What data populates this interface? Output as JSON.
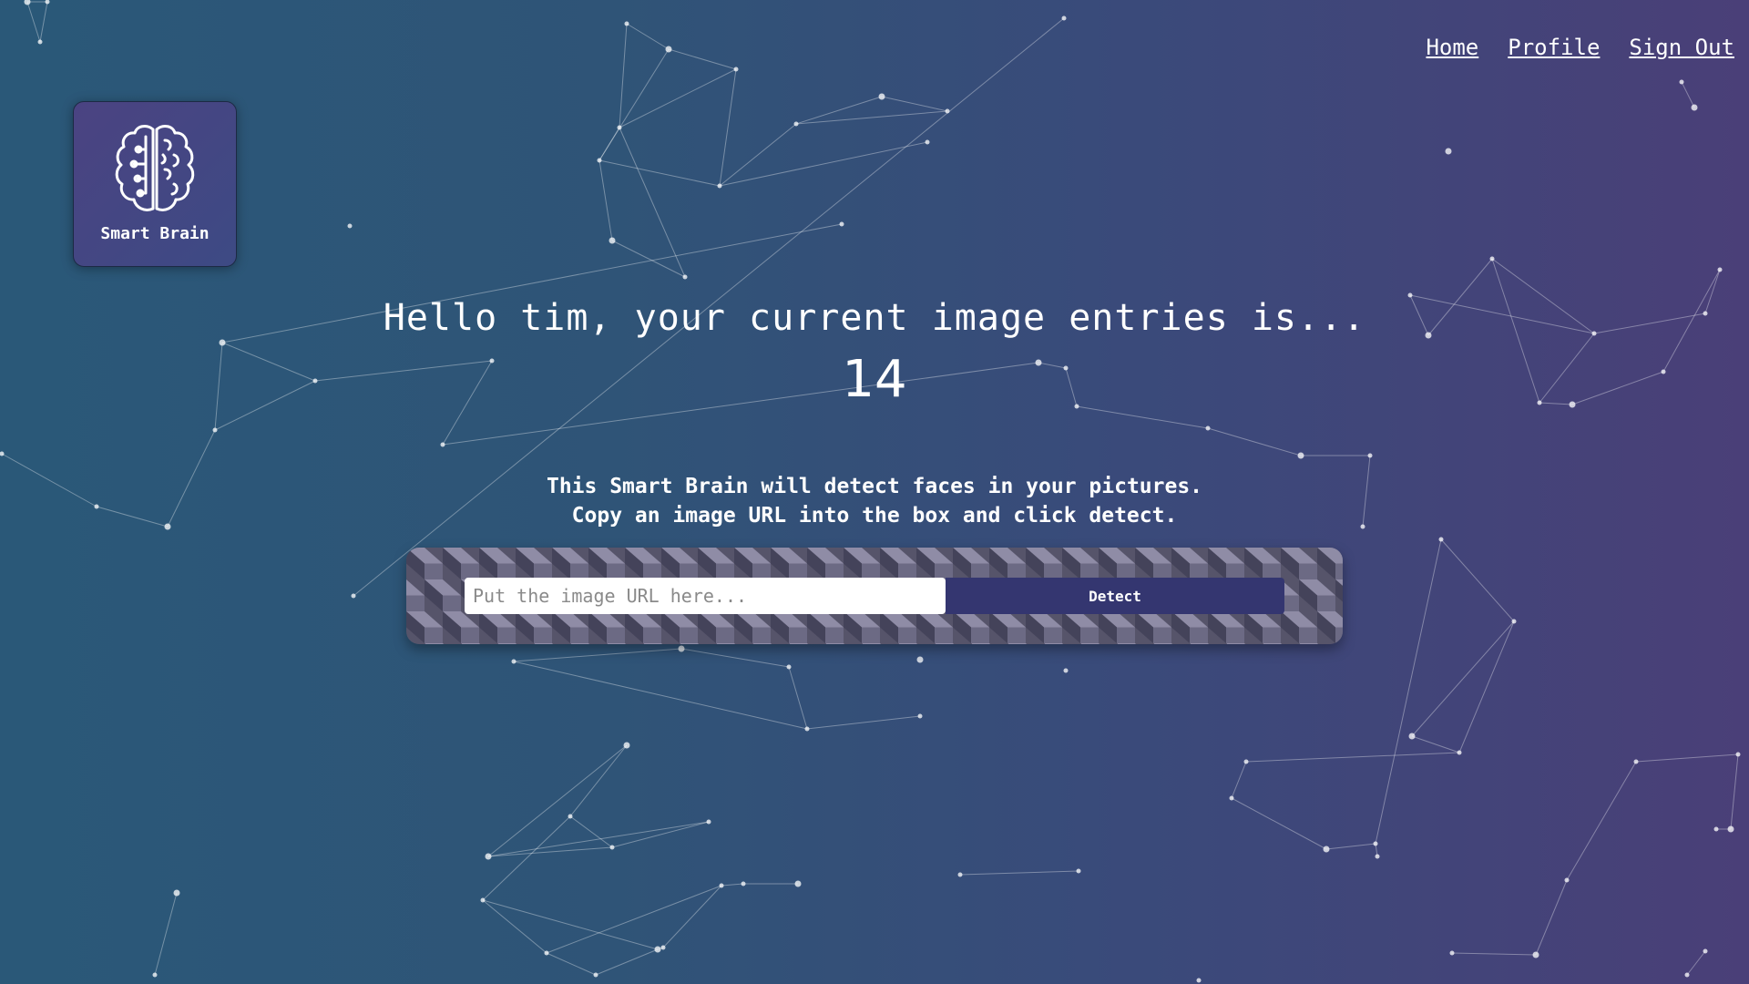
{
  "nav": {
    "home": "Home",
    "profile": "Profile",
    "sign_out": "Sign Out"
  },
  "logo": {
    "icon": "brain-circuit-icon",
    "label": "Smart Brain"
  },
  "rank": {
    "greeting": "Hello tim, your current image entries is...",
    "count": "14"
  },
  "form": {
    "line1": "This Smart Brain will detect faces in your pictures.",
    "line2": "Copy an image URL into the box and click detect.",
    "input_placeholder": "Put the image URL here...",
    "input_value": "",
    "button_label": "Detect"
  },
  "colors": {
    "background_left": "#2a5878",
    "background_right": "#4a3f78",
    "button": "#343670"
  }
}
